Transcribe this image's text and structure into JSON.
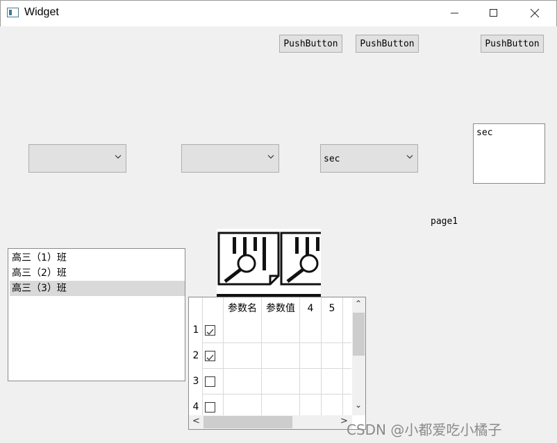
{
  "window": {
    "title": "Widget",
    "icon": "app-window-icon"
  },
  "titlebar_buttons": [
    "minimize-icon",
    "maximize-icon",
    "close-icon"
  ],
  "buttons": [
    "PushButton",
    "PushButton",
    "PushButton"
  ],
  "combos": [
    {
      "value": ""
    },
    {
      "value": ""
    },
    {
      "value": "sec"
    }
  ],
  "textbox": {
    "value": "sec"
  },
  "page_label": "page1",
  "list": {
    "items": [
      "高三（1）班",
      "高三（2）班",
      "高三（3）班"
    ],
    "selected_index": 2
  },
  "images": [
    "document-search-icon",
    "document-search-icon"
  ],
  "table": {
    "columns": [
      "参数名",
      "参数值",
      "4",
      "5"
    ],
    "rows": [
      {
        "header": "1",
        "checked": true
      },
      {
        "header": "2",
        "checked": true
      },
      {
        "header": "3",
        "checked": false
      },
      {
        "header": "4",
        "checked": false
      }
    ],
    "scroll_up_glyph": "⌃",
    "scroll_down_glyph": "⌄",
    "scroll_left_glyph": "<",
    "scroll_right_glyph": ">"
  },
  "watermark": "CSDN @小都爱吃小橘子"
}
